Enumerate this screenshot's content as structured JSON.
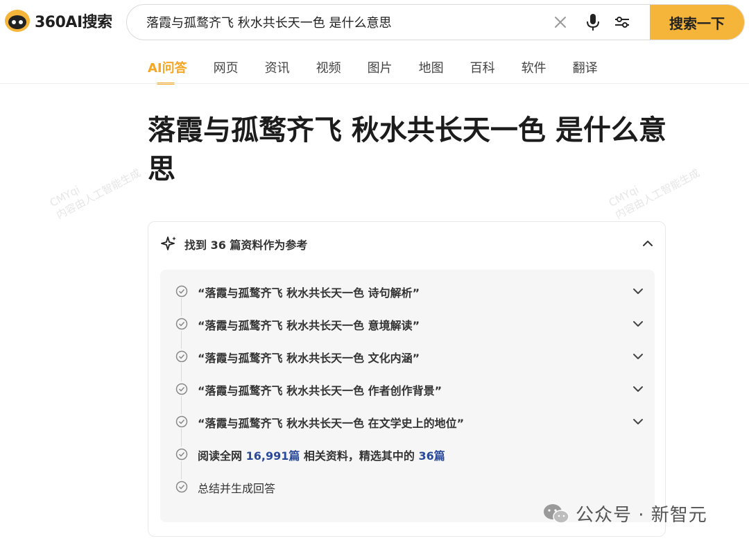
{
  "brand": {
    "name": "360AI搜索"
  },
  "search": {
    "query": "落霞与孤鹜齐飞 秋水共长天一色 是什么意思",
    "button_label": "搜索一下"
  },
  "tabs": [
    {
      "label": "AI问答",
      "active": true
    },
    {
      "label": "网页"
    },
    {
      "label": "资讯"
    },
    {
      "label": "视频"
    },
    {
      "label": "图片"
    },
    {
      "label": "地图"
    },
    {
      "label": "百科"
    },
    {
      "label": "软件"
    },
    {
      "label": "翻译"
    }
  ],
  "watermark": {
    "line1": "CMYqi",
    "line2": "内容由人工智能生成"
  },
  "main": {
    "title": "落霞与孤鹜齐飞 秋水共长天一色 是什么意思"
  },
  "references": {
    "header": "找到 36 篇资料作为参考",
    "steps": [
      {
        "text": "“落霞与孤鹜齐飞 秋水共长天一色 诗句解析”"
      },
      {
        "text": "“落霞与孤鹜齐飞 秋水共长天一色 意境解读”"
      },
      {
        "text": "“落霞与孤鹜齐飞 秋水共长天一色 文化内涵”"
      },
      {
        "text": "“落霞与孤鹜齐飞 秋水共长天一色 作者创作背景”"
      },
      {
        "text": "“落霞与孤鹜齐飞 秋水共长天一色 在文学史上的地位”"
      }
    ],
    "read_step": {
      "prefix": "阅读全网",
      "total": "16,991篇",
      "middle": "相关资料，精选其中的",
      "selected": "36篇"
    },
    "final_step": "总结并生成回答"
  },
  "footer_watermark": {
    "text": "公众号 · 新智元"
  },
  "colors": {
    "accent": "#f5a623",
    "button": "#f5b43a",
    "highlight": "#2b4a9a"
  }
}
